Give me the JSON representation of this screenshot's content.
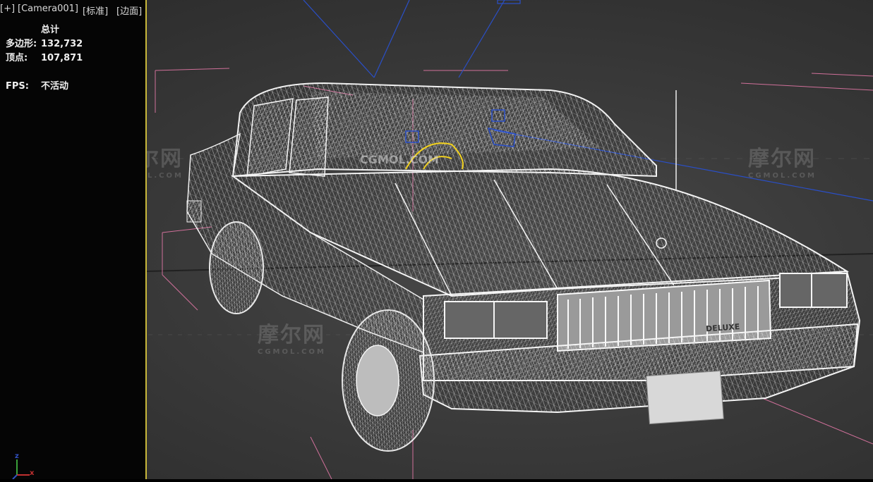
{
  "viewport": {
    "labels": {
      "plus": "[+]",
      "camera": "[Camera001]",
      "mode": "[标准]",
      "shading": "[边面]"
    },
    "stats": {
      "heading": "总计",
      "polygons_label": "多边形:",
      "polygons_value": "132,732",
      "vertices_label": "顶点:",
      "vertices_value": "107,871",
      "fps_label": "FPS:",
      "fps_value": "不活动"
    },
    "watermarks": {
      "cn": "摩尔网",
      "en": "CGMOL.COM",
      "brand": "CGMOL",
      "center_text": "CGMOL.COM"
    },
    "plate_text": "DELUXE",
    "axis": {
      "z": "z",
      "x": "x"
    },
    "colors": {
      "active_border": "#c9b83a",
      "wire": "#e8e8e8",
      "blue_line": "#2a4fc8",
      "pink_line": "#d0709a",
      "gizmo_yellow": "#f0d020"
    }
  }
}
